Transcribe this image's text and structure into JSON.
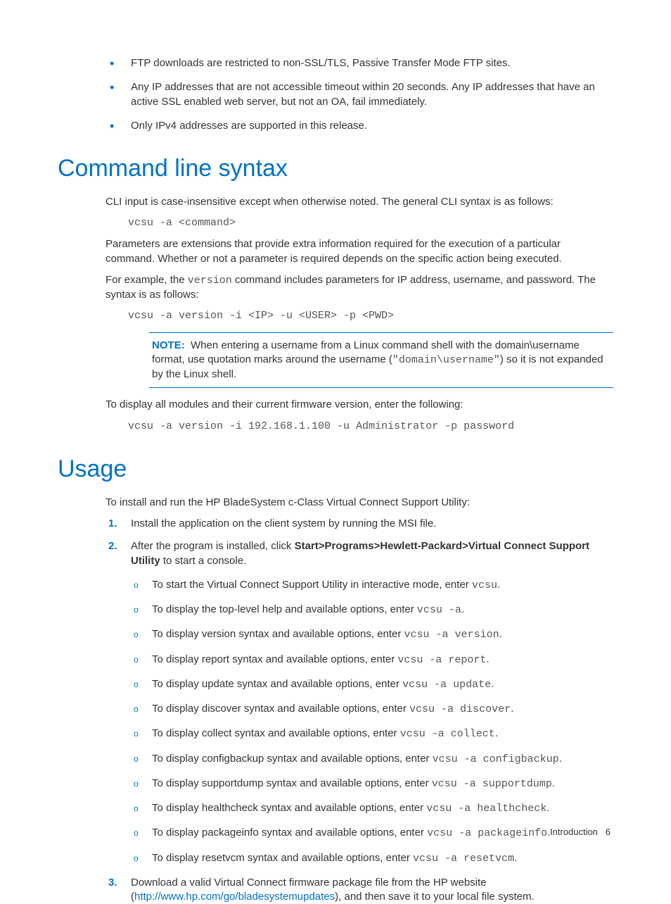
{
  "intro_bullets": {
    "b1": "FTP downloads are restricted to non-SSL/TLS, Passive Transfer Mode FTP sites.",
    "b2": "Any IP addresses that are not accessible timeout within 20 seconds. Any IP addresses that have an active SSL enabled web server, but not an OA, fail immediately.",
    "b3": "Only IPv4 addresses are supported in this release."
  },
  "syntax": {
    "heading": "Command line syntax",
    "p1": "CLI input is case-insensitive except when otherwise noted. The general CLI syntax is as follows:",
    "code1": "vcsu -a <command>",
    "p2": "Parameters are extensions that provide extra information required for the execution of a particular command. Whether or not a parameter is required depends on the specific action being executed.",
    "p3a": "For example, the ",
    "p3_code": "version",
    "p3b": " command includes parameters for IP address, username, and password. The syntax is as follows:",
    "code2": "vcsu -a version -i <IP> -u <USER> -p <PWD>",
    "note_label": "NOTE:",
    "note_a": "When entering a username from a Linux command shell with the domain\\username format, use quotation marks around the username (",
    "note_code": "\"domain\\username\"",
    "note_b": ") so it is not expanded by the Linux shell.",
    "p4": "To display all modules and their current firmware version, enter the following:",
    "code3": "vcsu -a version -i 192.168.1.100 -u Administrator -p password"
  },
  "usage": {
    "heading": "Usage",
    "p1": "To install and run the HP BladeSystem c-Class Virtual Connect Support Utility:",
    "step1": "Install the application on the client system by running the MSI file.",
    "step2a": "After the program is installed, click ",
    "step2_bold": "Start>Programs>Hewlett-Packard>Virtual Connect Support Utility",
    "step2b": " to start a console.",
    "sub": {
      "s1a": "To start the Virtual Connect Support Utility in interactive mode, enter ",
      "s1c": "vcsu",
      "s2a": "To display the top-level help and available options, enter ",
      "s2c": "vcsu -a",
      "s3a": "To display version syntax and available options, enter ",
      "s3c": "vcsu -a version",
      "s4a": "To display report syntax and available options, enter ",
      "s4c": "vcsu -a report",
      "s5a": "To display update syntax and available options, enter ",
      "s5c": "vcsu -a update",
      "s6a": "To display discover syntax and available options, enter ",
      "s6c": "vcsu -a discover",
      "s7a": "To display collect syntax and available options, enter ",
      "s7c": "vcsu -a collect",
      "s8a": "To display configbackup syntax and available options, enter ",
      "s8c": "vcsu -a configbackup",
      "s9a": "To display supportdump syntax and available options, enter ",
      "s9c": "vcsu -a supportdump",
      "s10a": "To display healthcheck syntax and available options, enter ",
      "s10c": "vcsu -a healthcheck",
      "s11a": "To display packageinfo syntax and available options, enter ",
      "s11c": "vcsu -a packageinfo",
      "s12a": "To display resetvcm syntax and available options, enter ",
      "s12c": "vcsu -a resetvcm"
    },
    "step3a": "Download a valid Virtual Connect firmware package file from the HP website (",
    "step3_link": "http://www.hp.com/go/bladesystemupdates",
    "step3b": "), and then save it to your local file system."
  },
  "footer": {
    "section": "Introduction",
    "page": "6"
  }
}
